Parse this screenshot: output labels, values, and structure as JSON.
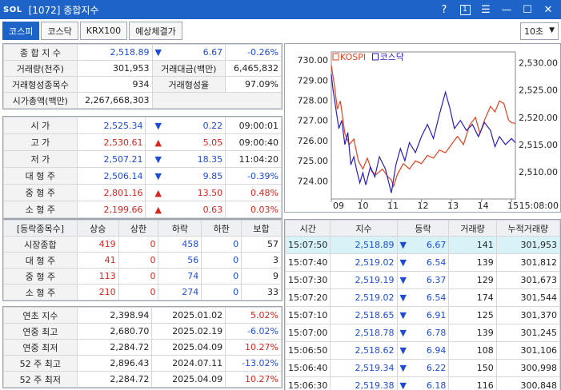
{
  "window": {
    "logo": "SOL",
    "title": "[1072] 종합지수",
    "help_label": "?",
    "page_num": "1",
    "menu_label": "☰",
    "minimize_label": "—",
    "maximize_label": "☐",
    "close_label": "✕"
  },
  "tabs": [
    {
      "label": "코스피",
      "active": true
    },
    {
      "label": "코스닥",
      "active": false
    },
    {
      "label": "KRX100",
      "active": false
    },
    {
      "label": "예상체결가",
      "active": false
    }
  ],
  "period_select": {
    "value": "10초"
  },
  "summary": {
    "index_label": "종 합 지 수",
    "index_value": "2,518.89",
    "index_arrow": "▼",
    "index_change": "6.67",
    "index_pct": "-0.26%",
    "volume_label": "거래량(천주)",
    "volume_value": "301,953",
    "amount_label": "거래대금(백만)",
    "amount_value": "6,465,832",
    "formed_count_label": "거래형성종목수",
    "formed_count_value": "934",
    "formed_rate_label": "거래형성율",
    "formed_rate_value": "97.09%",
    "mcap_label": "시가총액(백만)",
    "mcap_value": "2,267,668,303"
  },
  "ohlc": [
    {
      "label": "시    가",
      "value": "2,525.34",
      "arrow": "▼",
      "change": "0.22",
      "extra": "09:00:01",
      "color": "blue",
      "extra_color": "black"
    },
    {
      "label": "고    가",
      "value": "2,530.61",
      "arrow": "▲",
      "change": "5.05",
      "extra": "09:00:40",
      "color": "red",
      "extra_color": "black"
    },
    {
      "label": "저    가",
      "value": "2,507.21",
      "arrow": "▼",
      "change": "18.35",
      "extra": "11:04:20",
      "color": "blue",
      "extra_color": "black"
    },
    {
      "label": "대 형 주",
      "value": "2,506.14",
      "arrow": "▼",
      "change": "9.85",
      "extra": "-0.39%",
      "color": "blue",
      "extra_color": "blue"
    },
    {
      "label": "중 형 주",
      "value": "2,801.16",
      "arrow": "▲",
      "change": "13.50",
      "extra": "0.48%",
      "color": "red",
      "extra_color": "red"
    },
    {
      "label": "소 형 주",
      "value": "2,199.66",
      "arrow": "▲",
      "change": "0.63",
      "extra": "0.03%",
      "color": "red",
      "extra_color": "red"
    }
  ],
  "breadth": {
    "headers": [
      "[등락종목수]",
      "상승",
      "상한",
      "하락",
      "하한",
      "보합"
    ],
    "rows": [
      {
        "label": "시장종합",
        "values": [
          "419",
          "0",
          "458",
          "0",
          "57"
        ]
      },
      {
        "label": "대 형 주",
        "values": [
          "41",
          "0",
          "56",
          "0",
          "3"
        ]
      },
      {
        "label": "중 형 주",
        "values": [
          "113",
          "0",
          "74",
          "0",
          "9"
        ]
      },
      {
        "label": "소 형 주",
        "values": [
          "210",
          "0",
          "274",
          "0",
          "33"
        ]
      }
    ]
  },
  "yearly": [
    {
      "label": "연초  지수",
      "value": "2,398.94",
      "date": "2025.01.02",
      "pct": "5.02%",
      "color": "red"
    },
    {
      "label": "연중  최고",
      "value": "2,680.70",
      "date": "2025.02.19",
      "pct": "-6.02%",
      "color": "blue"
    },
    {
      "label": "연중  최저",
      "value": "2,284.72",
      "date": "2025.04.09",
      "pct": "10.27%",
      "color": "red"
    },
    {
      "label": "52 주 최고",
      "value": "2,896.43",
      "date": "2024.07.11",
      "pct": "-13.02%",
      "color": "blue"
    },
    {
      "label": "52 주 최저",
      "value": "2,284.72",
      "date": "2025.04.09",
      "pct": "10.27%",
      "color": "red"
    }
  ],
  "ticks": {
    "headers": [
      "시간",
      "지수",
      "등락",
      "거래량",
      "누적거래량"
    ],
    "rows": [
      {
        "time": "15:07:50",
        "index": "2,518.89",
        "arrow": "▼",
        "change": "6.67",
        "vol": "141",
        "cum": "301,953"
      },
      {
        "time": "15:07:40",
        "index": "2,519.02",
        "arrow": "▼",
        "change": "6.54",
        "vol": "139",
        "cum": "301,812"
      },
      {
        "time": "15:07:30",
        "index": "2,519.19",
        "arrow": "▼",
        "change": "6.37",
        "vol": "129",
        "cum": "301,673"
      },
      {
        "time": "15:07:20",
        "index": "2,519.02",
        "arrow": "▼",
        "change": "6.54",
        "vol": "174",
        "cum": "301,544"
      },
      {
        "time": "15:07:10",
        "index": "2,518.65",
        "arrow": "▼",
        "change": "6.91",
        "vol": "125",
        "cum": "301,370"
      },
      {
        "time": "15:07:00",
        "index": "2,518.78",
        "arrow": "▼",
        "change": "6.78",
        "vol": "139",
        "cum": "301,245"
      },
      {
        "time": "15:06:50",
        "index": "2,518.62",
        "arrow": "▼",
        "change": "6.94",
        "vol": "108",
        "cum": "301,106"
      },
      {
        "time": "15:06:40",
        "index": "2,519.34",
        "arrow": "▼",
        "change": "6.22",
        "vol": "150",
        "cum": "300,998"
      },
      {
        "time": "15:06:30",
        "index": "2,519.38",
        "arrow": "▼",
        "change": "6.18",
        "vol": "116",
        "cum": "300,848"
      }
    ]
  },
  "chart": {
    "legend": [
      {
        "name": "KOSPI",
        "color": "#e8401c"
      },
      {
        "name": "코스닥",
        "color": "#2a1fc0"
      }
    ],
    "left_ticks": [
      "730.00",
      "729.00",
      "728.00",
      "727.00",
      "726.00",
      "725.00",
      "724.00"
    ],
    "right_ticks": [
      "2,530.00",
      "2,525.00",
      "2,520.00",
      "2,515.00",
      "2,510.00"
    ],
    "x_ticks": [
      "09",
      "10",
      "11",
      "12",
      "13",
      "14",
      "15"
    ],
    "end_time": "15:08:00",
    "x_range": [
      9,
      15.13
    ],
    "kospi_range": [
      2505,
      2532
    ],
    "kosdaq_range": [
      723.1,
      730.4
    ],
    "kospi": [
      [
        9.0,
        2529.5
      ],
      [
        9.1,
        2526
      ],
      [
        9.2,
        2521.5
      ],
      [
        9.3,
        2523
      ],
      [
        9.45,
        2517
      ],
      [
        9.6,
        2515
      ],
      [
        9.75,
        2516
      ],
      [
        9.9,
        2512
      ],
      [
        10.05,
        2510.5
      ],
      [
        10.2,
        2512.5
      ],
      [
        10.35,
        2510
      ],
      [
        10.5,
        2509.5
      ],
      [
        10.7,
        2510.5
      ],
      [
        10.9,
        2509
      ],
      [
        11.0,
        2508.5
      ],
      [
        11.07,
        2507.3
      ],
      [
        11.2,
        2509.5
      ],
      [
        11.4,
        2511.5
      ],
      [
        11.6,
        2510.5
      ],
      [
        11.8,
        2512
      ],
      [
        12.0,
        2511.5
      ],
      [
        12.2,
        2513
      ],
      [
        12.4,
        2512.5
      ],
      [
        12.6,
        2514
      ],
      [
        12.8,
        2513.5
      ],
      [
        13.0,
        2515
      ],
      [
        13.2,
        2516.5
      ],
      [
        13.4,
        2515
      ],
      [
        13.6,
        2518.5
      ],
      [
        13.8,
        2520
      ],
      [
        13.95,
        2517
      ],
      [
        14.1,
        2519.5
      ],
      [
        14.3,
        2522
      ],
      [
        14.45,
        2521
      ],
      [
        14.6,
        2523
      ],
      [
        14.75,
        2522.5
      ],
      [
        14.9,
        2519.5
      ],
      [
        15.0,
        2519
      ],
      [
        15.13,
        2518.9
      ]
    ],
    "kosdaq": [
      [
        9.0,
        729.3
      ],
      [
        9.05,
        728.6
      ],
      [
        9.15,
        727.6
      ],
      [
        9.25,
        726.6
      ],
      [
        9.35,
        727.0
      ],
      [
        9.45,
        725.8
      ],
      [
        9.55,
        726.4
      ],
      [
        9.65,
        724.8
      ],
      [
        9.75,
        725.2
      ],
      [
        9.85,
        724.5
      ],
      [
        9.95,
        723.9
      ],
      [
        10.05,
        724.4
      ],
      [
        10.15,
        723.8
      ],
      [
        10.3,
        724.7
      ],
      [
        10.45,
        724.2
      ],
      [
        10.6,
        725.2
      ],
      [
        10.8,
        724.6
      ],
      [
        11.0,
        723.4
      ],
      [
        11.15,
        724.8
      ],
      [
        11.3,
        725.6
      ],
      [
        11.45,
        725.0
      ],
      [
        11.6,
        725.9
      ],
      [
        11.8,
        725.4
      ],
      [
        12.0,
        726.2
      ],
      [
        12.2,
        726.8
      ],
      [
        12.4,
        726.1
      ],
      [
        12.6,
        727.3
      ],
      [
        12.8,
        728.4
      ],
      [
        12.95,
        727.6
      ],
      [
        13.1,
        726.6
      ],
      [
        13.3,
        727.0
      ],
      [
        13.5,
        726.5
      ],
      [
        13.7,
        726.8
      ],
      [
        13.9,
        726.2
      ],
      [
        14.1,
        726.9
      ],
      [
        14.3,
        726.5
      ],
      [
        14.45,
        725.7
      ],
      [
        14.6,
        726.2
      ],
      [
        14.8,
        725.8
      ],
      [
        15.0,
        726.1
      ],
      [
        15.13,
        725.9
      ]
    ]
  }
}
